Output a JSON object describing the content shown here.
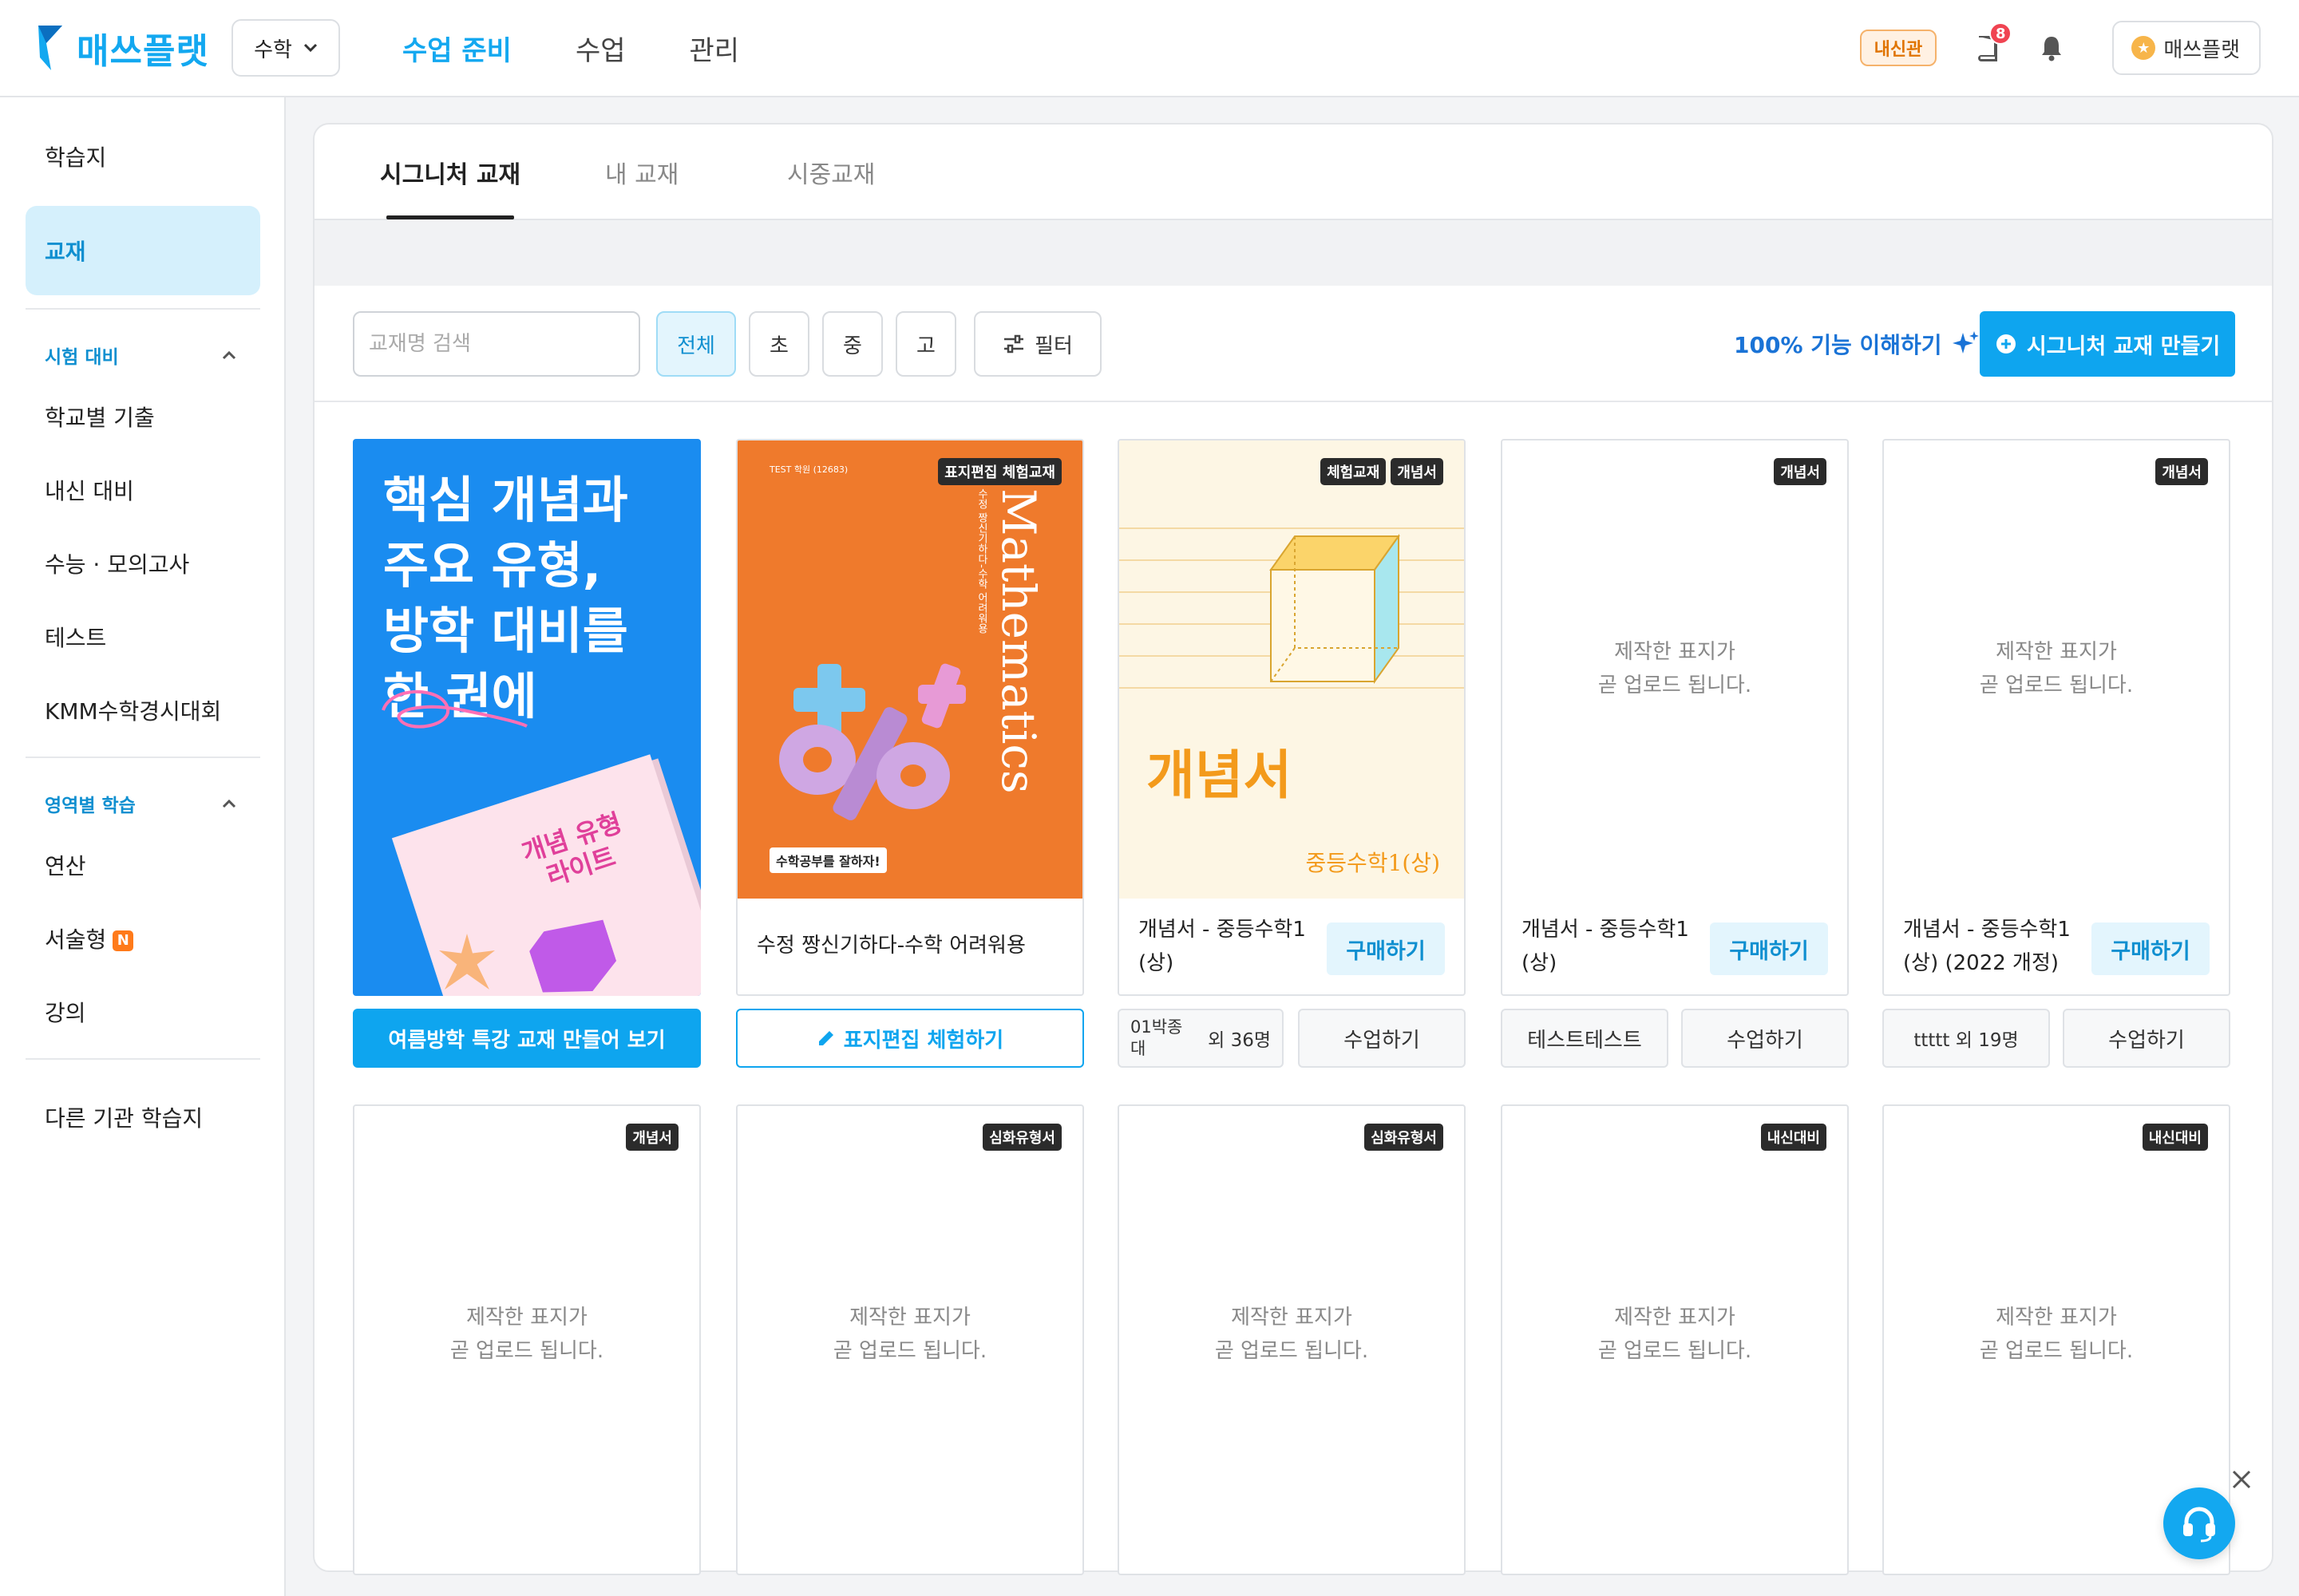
{
  "header": {
    "logo_text": "매쓰플랫",
    "subject": "수학",
    "nav": [
      "수업 준비",
      "수업",
      "관리"
    ],
    "badge": "내신관",
    "notification_count": "8",
    "profile_name": "매쓰플랫",
    "colors": {
      "brand": "#13a8f0",
      "badge_orange": "#e07400",
      "alert_red": "#f04452"
    }
  },
  "sidebar": {
    "top_items": [
      "학습지",
      "교재"
    ],
    "active": "교재",
    "section1": {
      "title": "시험 대비",
      "items": [
        "학교별 기출",
        "내신 대비",
        "수능 · 모의고사",
        "테스트",
        "KMM수학경시대회"
      ]
    },
    "section2": {
      "title": "영역별 학습",
      "items": [
        "연산",
        "서술형",
        "강의"
      ],
      "new_badge": "N"
    },
    "bottom_item": "다른 기관 학습지"
  },
  "tabs": [
    "시그니처 교재",
    "내 교재",
    "시중교재"
  ],
  "toolbar": {
    "search_placeholder": "교재명 검색",
    "levels": [
      "전체",
      "초",
      "중",
      "고"
    ],
    "filter_label": "필터",
    "understand_label": "100% 기능 이해하기",
    "create_label": "시그니처 교재 만들기"
  },
  "cards_row1": [
    {
      "promo_title": "핵심 개념과\n주요 유형,\n방학 대비를\n한 권에",
      "book_label": "개념 유형\n라이트",
      "action": "여름방학 특강 교재 만들어 보기"
    },
    {
      "tags": [
        "표지편집 체험교재"
      ],
      "cover_small": "TEST 학원 (12683)",
      "cover_big": "Mathematics",
      "cover_vertical_sub": "수정 짱신기하다-수학 어려워용",
      "cover_sticker": "수학공부를 잘하자!",
      "title": "수정 짱신기하다-수학 어려워용",
      "action": "표지편집 체험하기"
    },
    {
      "tags": [
        "체험교재",
        "개념서"
      ],
      "cover_word": "개념서",
      "cover_sub": "중등수학1(상)",
      "title": "개념서 - 중등수학1 (상)",
      "buy": "구매하기",
      "member": "01박종대",
      "member_more": "외 36명",
      "action": "수업하기"
    },
    {
      "tags": [
        "개념서"
      ],
      "placeholder": "제작한 표지가\n곧 업로드 됩니다.",
      "title": "개념서 - 중등수학1 (상)",
      "buy": "구매하기",
      "member": "테스트테스트",
      "action": "수업하기"
    },
    {
      "tags": [
        "개념서"
      ],
      "placeholder": "제작한 표지가\n곧 업로드 됩니다.",
      "title": "개념서 - 중등수학1 (상) (2022 개정)",
      "buy": "구매하기",
      "member": "ttttt 외 19명",
      "action": "수업하기"
    }
  ],
  "cards_row2": [
    {
      "tag": "개념서",
      "placeholder": "제작한 표지가\n곧 업로드 됩니다."
    },
    {
      "tag": "심화유형서",
      "placeholder": "제작한 표지가\n곧 업로드 됩니다."
    },
    {
      "tag": "심화유형서",
      "placeholder": "제작한 표지가\n곧 업로드 됩니다."
    },
    {
      "tag": "내신대비",
      "placeholder": "제작한 표지가\n곧 업로드 됩니다."
    },
    {
      "tag": "내신대비",
      "placeholder": "제작한 표지가\n곧 업로드 됩니다."
    }
  ]
}
